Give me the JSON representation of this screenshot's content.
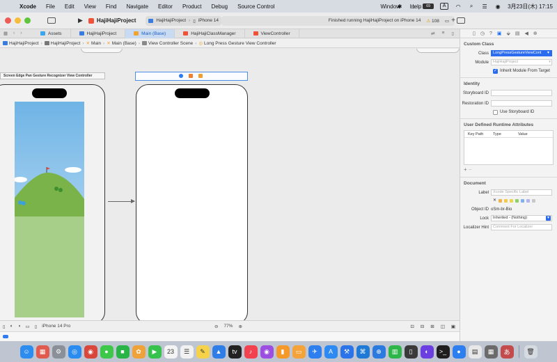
{
  "menubar": {
    "app_name": "Xcode",
    "items": [
      "File",
      "Edit",
      "View",
      "Find",
      "Navigate",
      "Editor",
      "Product",
      "Debug",
      "Source Control",
      "Window",
      "Help"
    ],
    "battery_label": "69",
    "input_method": "A",
    "clock": "3月23日(木) 17:15"
  },
  "toolbar": {
    "project_title": "HajiHajiProject",
    "scheme": "HajiHajiProject",
    "device": "iPhone 14",
    "status_text": "Finished running HajiHajiProject on iPhone 14",
    "warning_count": "108"
  },
  "tabs": [
    {
      "label": "Assets",
      "color": "#3aa7ec"
    },
    {
      "label": "HajiHajiProject",
      "color": "#3a7be0"
    },
    {
      "label": "Main (Base)",
      "color": "#f1a230",
      "active": true
    },
    {
      "label": "HajiHajiClassManager",
      "color": "#f05138"
    },
    {
      "label": "ViewController",
      "color": "#f05138"
    }
  ],
  "jumpbar": {
    "crumbs": [
      "HajiHajiProject",
      "HajiHajiProject",
      "Main",
      "Main (Base)",
      "View Controller Scene",
      "Long Press Gesture View Controller"
    ]
  },
  "canvas": {
    "scene_left_title": "Screen Edge Pan Gesture Recognizer View Controller",
    "colors": {
      "sky_top": "#6fb4e6",
      "sky_bottom": "#d3e9f7",
      "hill": "#7ab34a",
      "ground": "#a8cf8a"
    }
  },
  "bottombar": {
    "device_label": "iPhone 14 Pro",
    "zoom_level": "77%"
  },
  "inspector": {
    "custom_class": {
      "title": "Custom Class",
      "class_label": "Class",
      "class_value": "LongPressGestureViewCont",
      "module_label": "Module",
      "module_placeholder": "HajiHajiProject",
      "inherit_label": "Inherit Module From Target"
    },
    "identity": {
      "title": "Identity",
      "storyboard_id_label": "Storyboard ID",
      "restoration_id_label": "Restoration ID",
      "use_storyboard_label": "Use Storyboard ID"
    },
    "runtime_attrs": {
      "title": "User Defined Runtime Attributes",
      "col_key": "Key Path",
      "col_type": "Type",
      "col_value": "Value"
    },
    "document": {
      "title": "Document",
      "label_label": "Label",
      "label_placeholder": "Xcode Specific Label",
      "object_id_label": "Object ID",
      "object_id_value": "oSm-br-Bio",
      "lock_label": "Lock",
      "lock_value": "Inherited - (Nothing)",
      "hint_label": "Localizer Hint",
      "hint_placeholder": "Comment For Localizer",
      "swatch_colors": [
        "#f4b24c",
        "#f3c94f",
        "#e8d84e",
        "#8fd06b",
        "#7fb0ef",
        "#b3b3f0",
        "#c8c8c8"
      ]
    }
  },
  "dock": {
    "icons": [
      {
        "name": "finder-icon",
        "glyph": "☺",
        "color": "#2d8cf0"
      },
      {
        "name": "launchpad-icon",
        "glyph": "▦",
        "color": "#e05a4f"
      },
      {
        "name": "system-settings-icon",
        "glyph": "⚙",
        "color": "#8a8f98"
      },
      {
        "name": "safari-icon",
        "glyph": "◎",
        "color": "#2a8cf0"
      },
      {
        "name": "chrome-icon",
        "glyph": "◉",
        "color": "#d9463b"
      },
      {
        "name": "messages-icon",
        "glyph": "●",
        "color": "#3ec84a"
      },
      {
        "name": "line-icon",
        "glyph": "■",
        "color": "#28b446"
      },
      {
        "name": "photos-icon",
        "glyph": "✿",
        "color": "#f0a23a"
      },
      {
        "name": "facetime-icon",
        "glyph": "▶",
        "color": "#36c24b"
      },
      {
        "name": "calendar-icon",
        "glyph": "23",
        "color": "#f4f4f4"
      },
      {
        "name": "reminders-icon",
        "glyph": "☰",
        "color": "#f1f1f1"
      },
      {
        "name": "notes-icon",
        "glyph": "✎",
        "color": "#f6d24b"
      },
      {
        "name": "keynote-icon",
        "glyph": "▲",
        "color": "#2f7ee8"
      },
      {
        "name": "appletv-icon",
        "glyph": "tv",
        "color": "#222222"
      },
      {
        "name": "music-icon",
        "glyph": "♪",
        "color": "#f2414f"
      },
      {
        "name": "podcasts-icon",
        "glyph": "◉",
        "color": "#9b4ee0"
      },
      {
        "name": "books-icon",
        "glyph": "▮",
        "color": "#f59a2a"
      },
      {
        "name": "pages-icon",
        "glyph": "▭",
        "color": "#f3a33a"
      },
      {
        "name": "testflight-icon",
        "glyph": "✈",
        "color": "#2d7ff0"
      },
      {
        "name": "appstore-icon",
        "glyph": "A",
        "color": "#2c8af2"
      },
      {
        "name": "xcode-icon",
        "glyph": "⚒",
        "color": "#2a73e8"
      },
      {
        "name": "vscode-icon",
        "glyph": "⌘",
        "color": "#1e7ad6"
      },
      {
        "name": "instruments-icon",
        "glyph": "⊕",
        "color": "#2a7ae0"
      },
      {
        "name": "numbers-icon",
        "glyph": "▥",
        "color": "#2fb64a"
      },
      {
        "name": "simulator-icon",
        "glyph": "▯",
        "color": "#3a3a3a"
      },
      {
        "name": "github-icon",
        "glyph": "◐",
        "color": "#6a3ee0"
      },
      {
        "name": "terminal-icon",
        "glyph": ">_",
        "color": "#1e1e1e"
      },
      {
        "name": "zoom-icon",
        "glyph": "●",
        "color": "#2d7ff0"
      },
      {
        "name": "preview-icon",
        "glyph": "▤",
        "color": "#e8e8e8"
      },
      {
        "name": "screenshot-icon",
        "glyph": "▦",
        "color": "#6b6b6b"
      },
      {
        "name": "hajihaji-app-icon",
        "glyph": "あ",
        "color": "#c44b4b"
      },
      {
        "name": "trash-icon",
        "glyph": "🗑",
        "color": "#d6dbe2"
      }
    ]
  }
}
